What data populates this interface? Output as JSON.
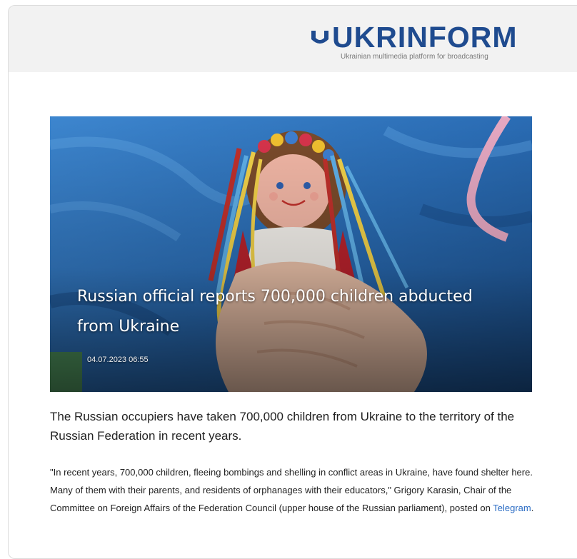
{
  "brand": {
    "name": "UKRINFORM",
    "tagline": "Ukrainian multimedia platform for broadcasting",
    "color": "#1f4b8f"
  },
  "article": {
    "title": "Russian official reports 700,000 children abducted from Ukraine",
    "date": "04.07.2023 06:55",
    "lead": "The Russian occupiers have taken 700,000 children from Ukraine to the territory of the Russian Federation in recent years.",
    "body_before_link": "\"In recent years, 700,000 children, fleeing bombings and shelling in conflict areas in Ukraine, have found shelter here. Many of them with their parents, and residents of orphanages with their educators,\" Grigory Karasin, Chair of the Committee on Foreign Affairs of the Federation Council (upper house of the Russian parliament), posted on ",
    "link_text": "Telegram",
    "body_after_link": ".",
    "link_color": "#2b6cc4"
  },
  "image": {
    "icon": "doll-photo"
  }
}
